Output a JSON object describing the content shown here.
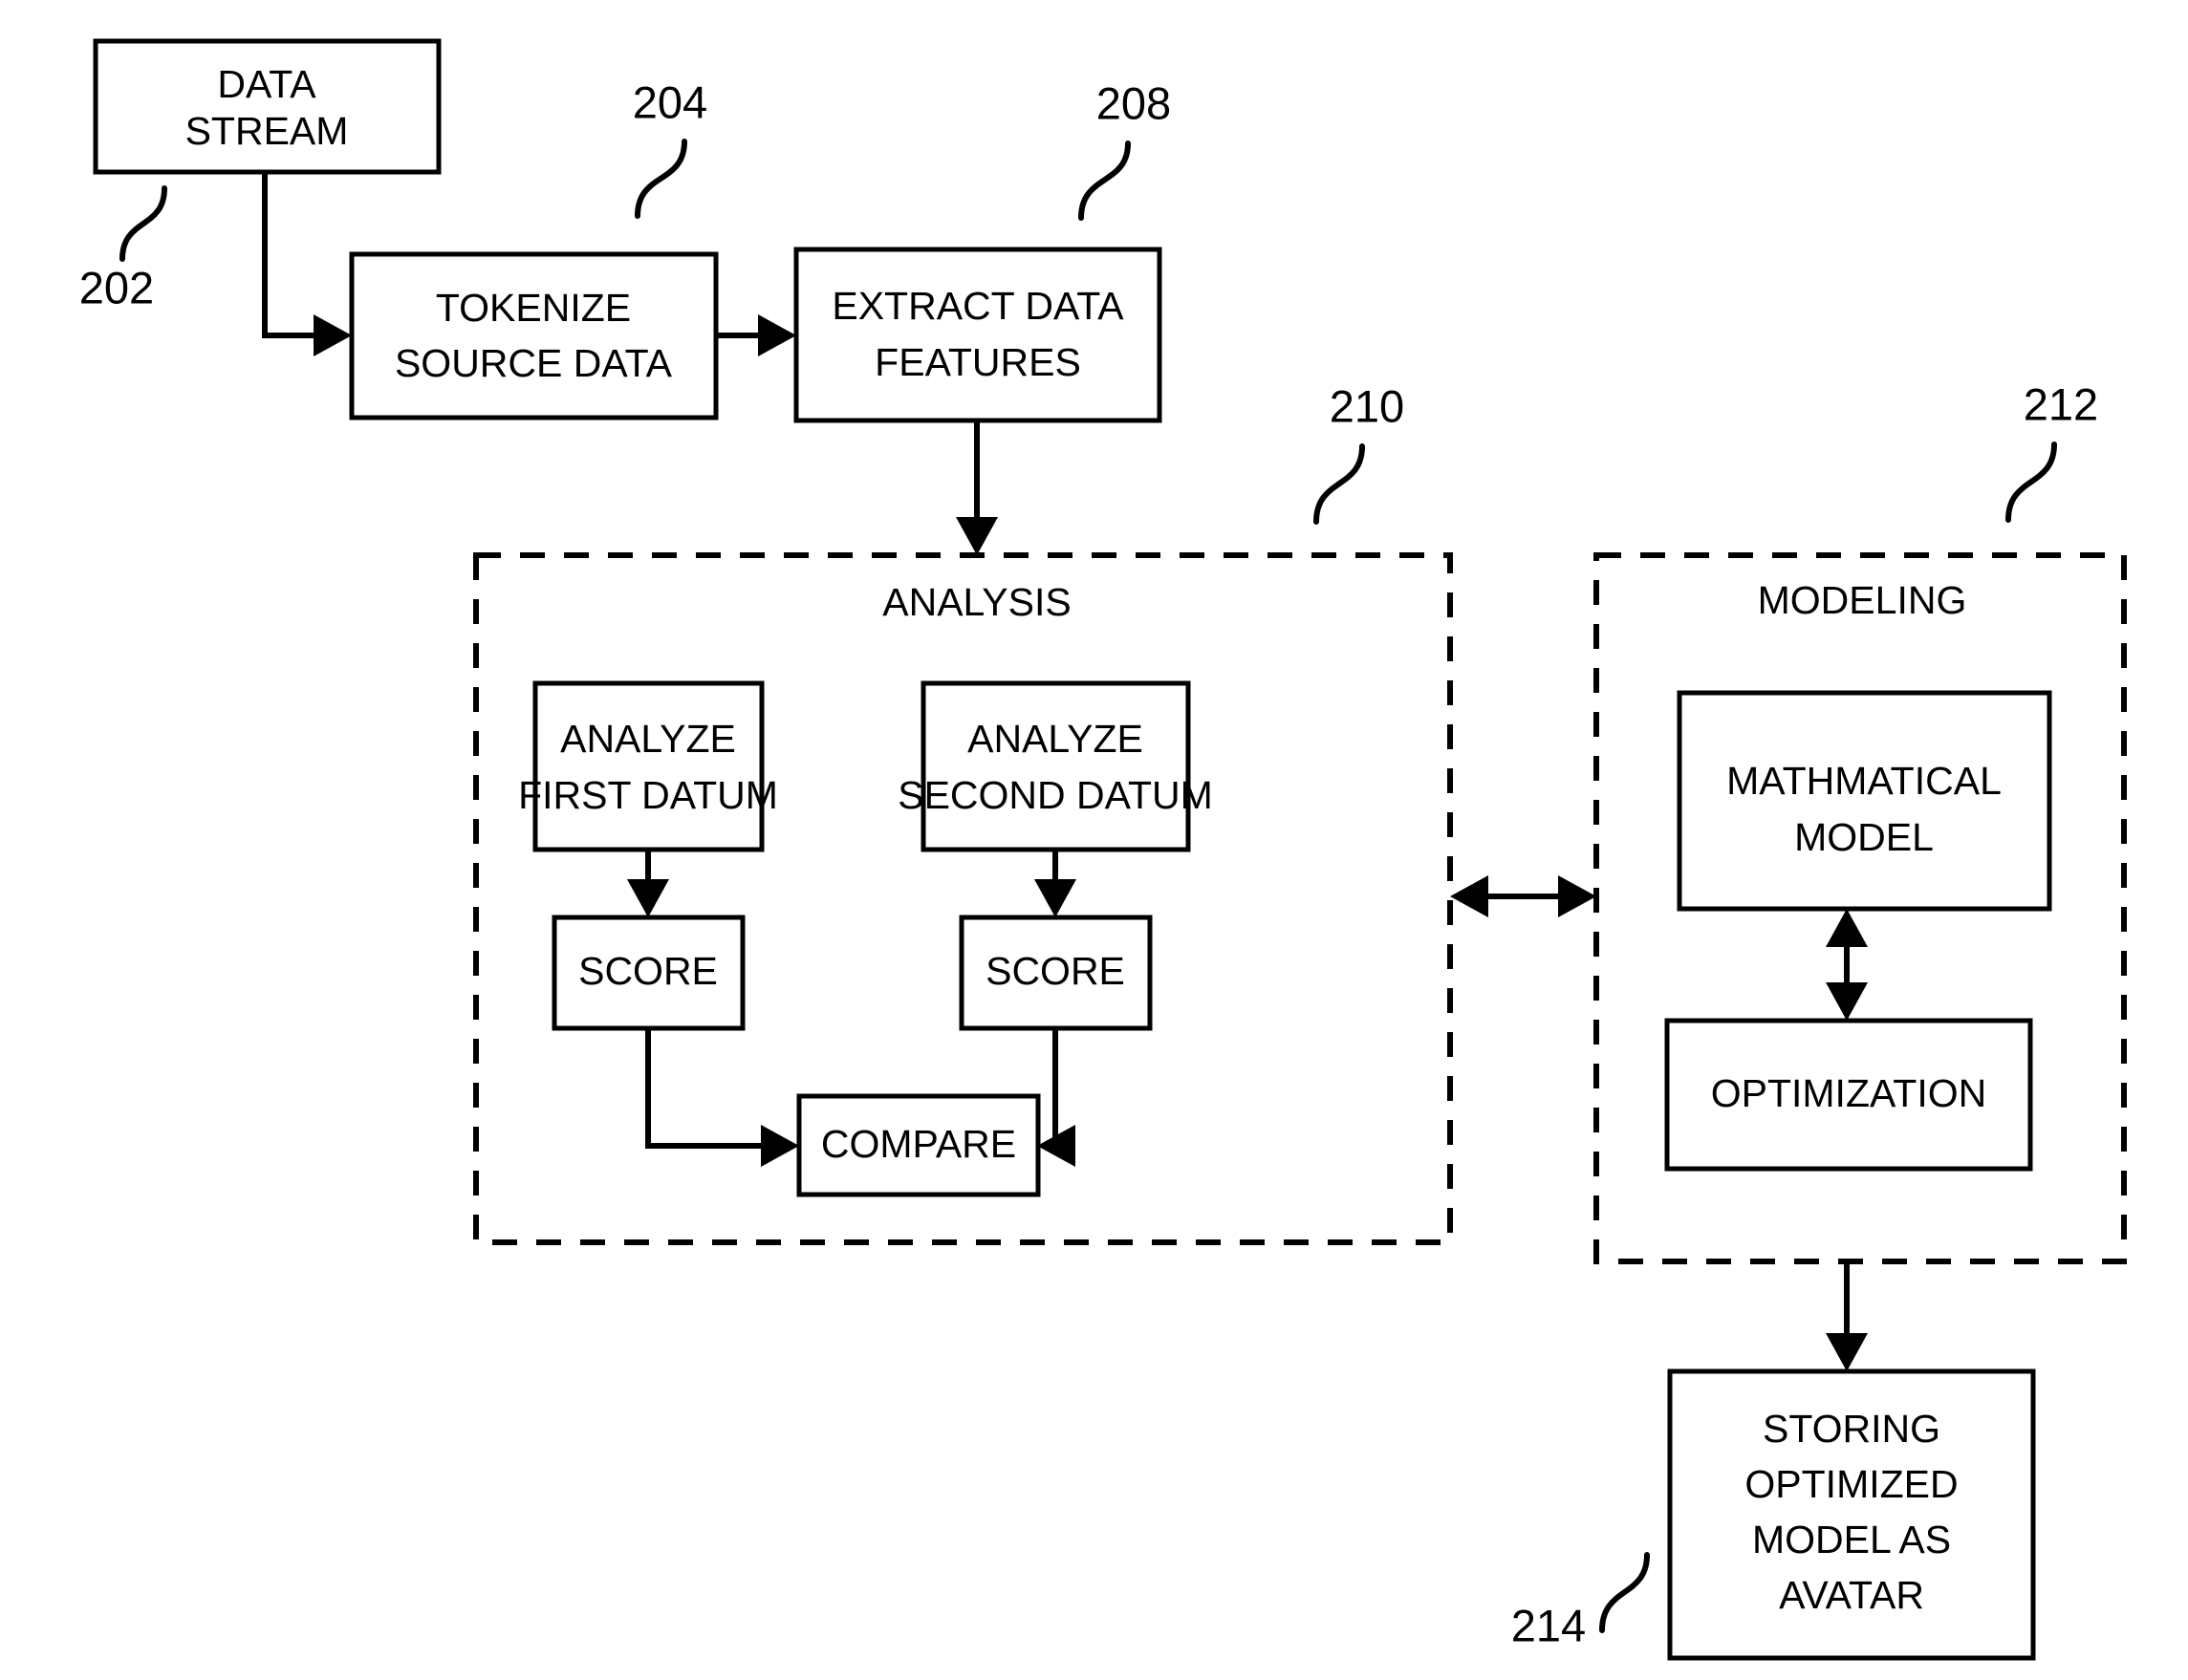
{
  "figure": {
    "type": "patent-flowchart",
    "background_color": "#ffffff",
    "line_color": "#000000",
    "boxes": [
      {
        "id": "data_stream",
        "lines": [
          "DATA",
          "STREAM"
        ]
      },
      {
        "id": "tokenize",
        "lines": [
          "TOKENIZE",
          "SOURCE DATA"
        ]
      },
      {
        "id": "extract",
        "lines": [
          "EXTRACT DATA",
          "FEATURES"
        ]
      },
      {
        "id": "analyze_first",
        "lines": [
          "ANALYZE",
          "FIRST DATUM"
        ]
      },
      {
        "id": "analyze_second",
        "lines": [
          "ANALYZE",
          "SECOND DATUM"
        ]
      },
      {
        "id": "score_first",
        "lines": [
          "SCORE"
        ]
      },
      {
        "id": "score_second",
        "lines": [
          "SCORE"
        ]
      },
      {
        "id": "compare",
        "lines": [
          "COMPARE"
        ]
      },
      {
        "id": "math_model",
        "lines": [
          "MATHMATICAL",
          "MODEL"
        ]
      },
      {
        "id": "optimization",
        "lines": [
          "OPTIMIZATION"
        ]
      },
      {
        "id": "storing",
        "lines": [
          "STORING",
          "OPTIMIZED",
          "MODEL AS",
          "AVATAR"
        ]
      }
    ],
    "groups": [
      {
        "id": "analysis",
        "label": "ANALYSIS"
      },
      {
        "id": "modeling",
        "label": "MODELING"
      }
    ],
    "reference_numerals": [
      {
        "id": "ref_202",
        "value": "202",
        "target": "data_stream"
      },
      {
        "id": "ref_204",
        "value": "204",
        "target": "tokenize"
      },
      {
        "id": "ref_208",
        "value": "208",
        "target": "extract"
      },
      {
        "id": "ref_210",
        "value": "210",
        "target": "analysis"
      },
      {
        "id": "ref_212",
        "value": "212",
        "target": "modeling"
      },
      {
        "id": "ref_214",
        "value": "214",
        "target": "storing"
      }
    ]
  }
}
